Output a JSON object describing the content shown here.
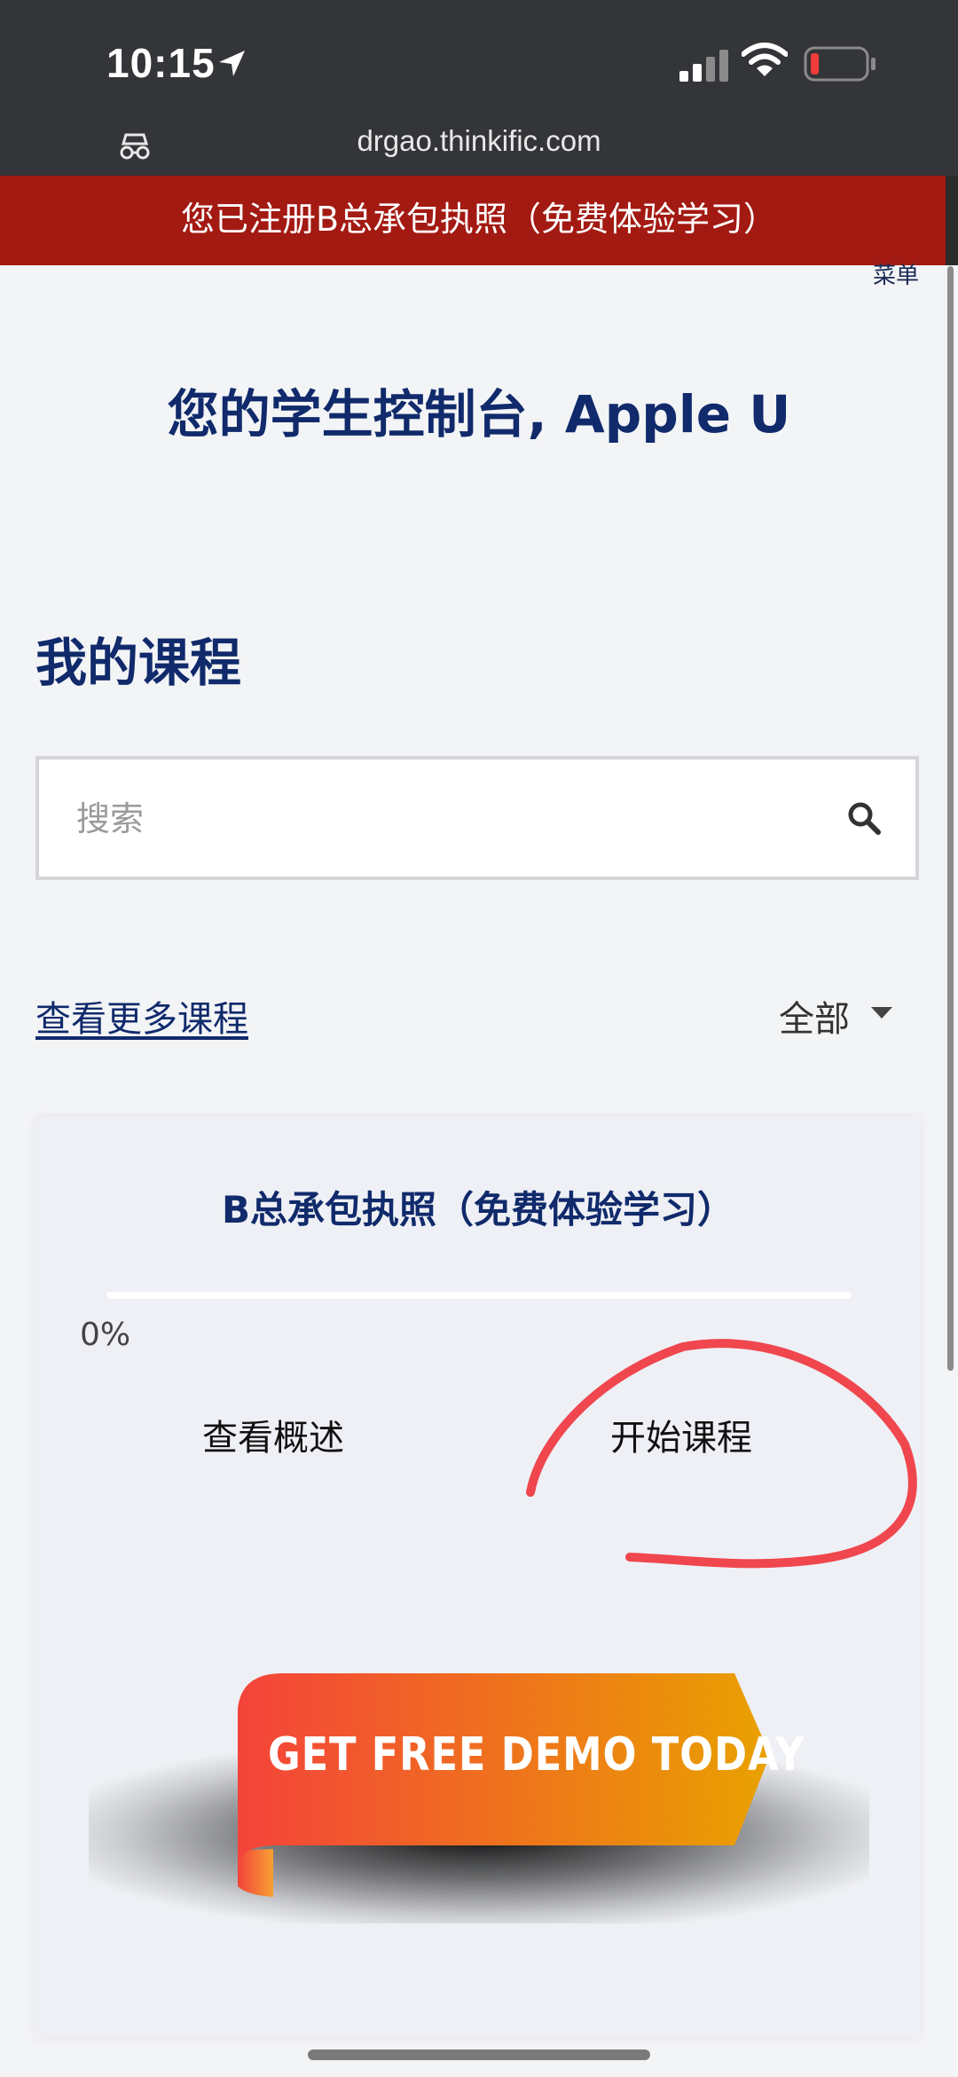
{
  "status_bar": {
    "time": "10:15",
    "url": "drgao.thinkific.com"
  },
  "banner": {
    "text": "您已注册B总承包执照（免费体验学习）",
    "color": "#a31a12"
  },
  "header": {
    "menu_label": "菜单"
  },
  "dashboard": {
    "title": "您的学生控制台, Apple U",
    "section_heading": "我的课程"
  },
  "search": {
    "placeholder": "搜索",
    "value": ""
  },
  "filters": {
    "more_courses_link": "查看更多课程",
    "selected": "全部"
  },
  "course_card": {
    "title": "B总承包执照（免费体验学习）",
    "progress_percent": 0,
    "progress_label": "0%",
    "overview_button": "查看概述",
    "start_button": "开始课程",
    "promo_text": "GET FREE DEMO TODAY",
    "promo_colors": [
      "#f4433a",
      "#e9a100"
    ]
  },
  "icons": [
    "location-arrow-icon",
    "signal-icon",
    "wifi-icon",
    "battery-icon",
    "reader-mode-icon",
    "search-icon",
    "caret-down-icon"
  ],
  "accent_color": "#102a6b",
  "annotation_color": "#f0464e"
}
